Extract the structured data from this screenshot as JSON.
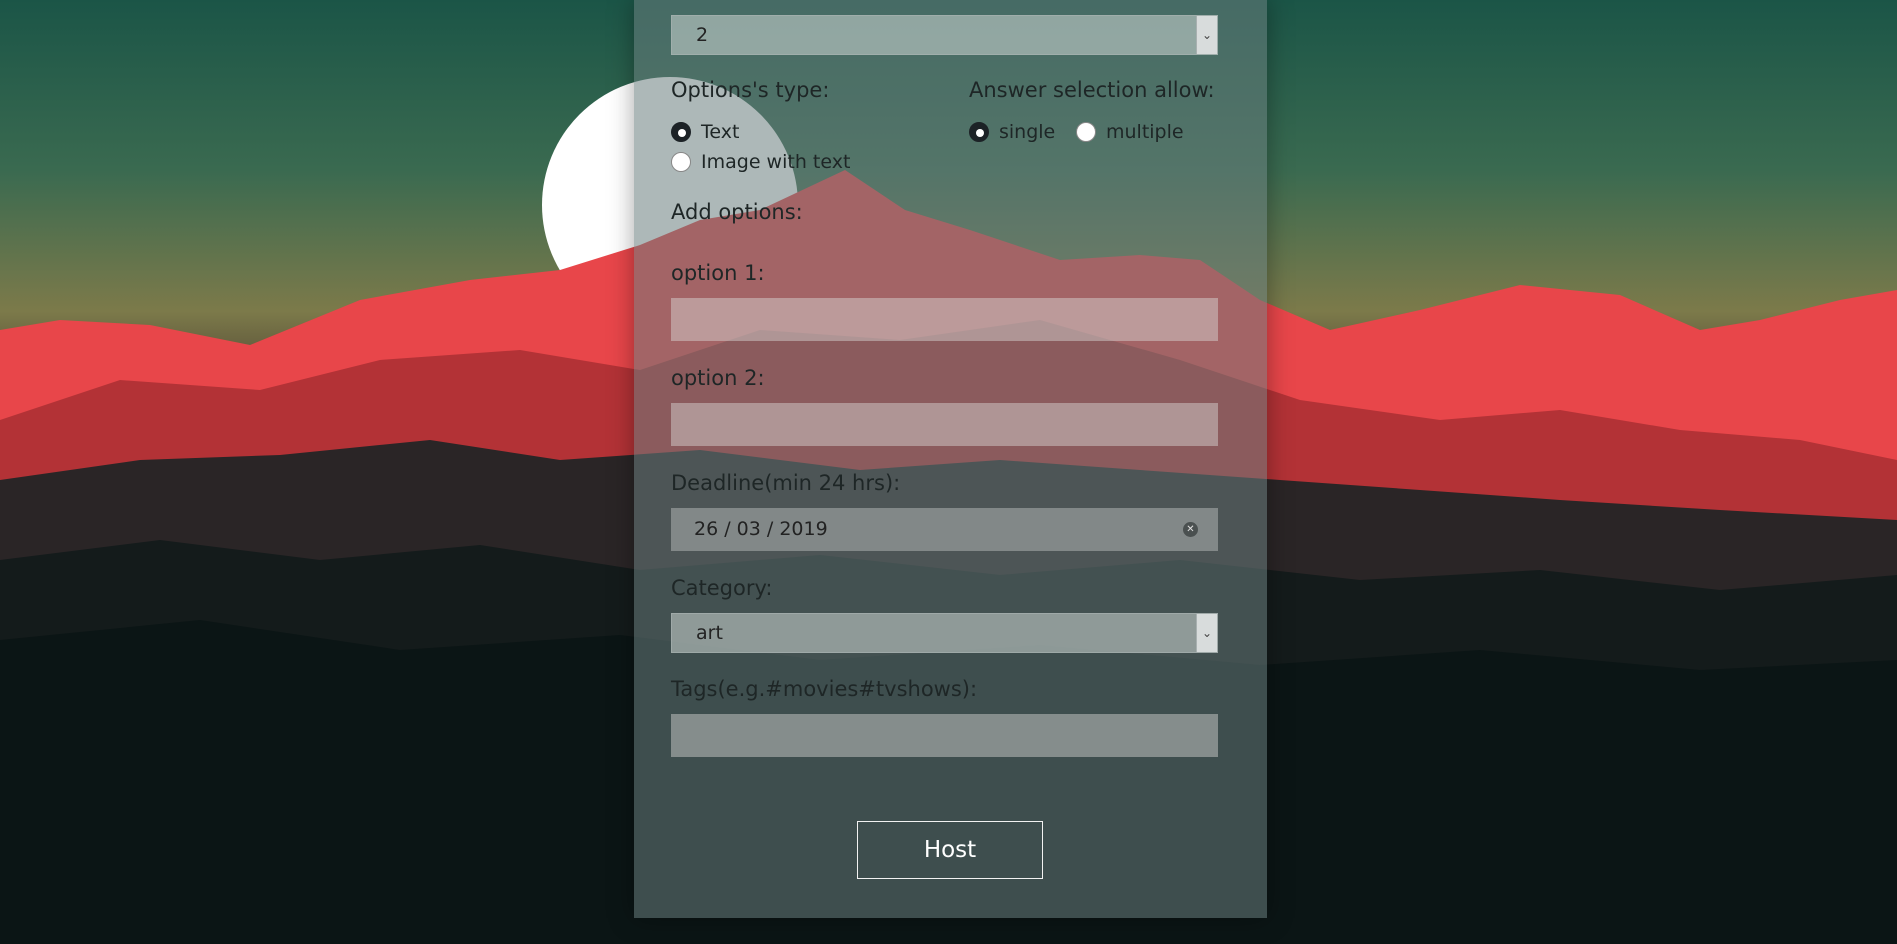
{
  "form": {
    "options_count": {
      "value": "2"
    },
    "options_type": {
      "label": "Options's type:",
      "choices": [
        {
          "label": "Text",
          "checked": true
        },
        {
          "label": "Image with text",
          "checked": false
        }
      ]
    },
    "answer_selection": {
      "label": "Answer selection allow:",
      "choices": [
        {
          "label": "single",
          "checked": true
        },
        {
          "label": "multiple",
          "checked": false
        }
      ]
    },
    "add_options_label": "Add options:",
    "options": [
      {
        "label": "option 1:",
        "value": ""
      },
      {
        "label": "option 2:",
        "value": ""
      }
    ],
    "deadline": {
      "label": "Deadline(min 24 hrs):",
      "value": "26 / 03 / 2019"
    },
    "category": {
      "label": "Category:",
      "value": "art"
    },
    "tags": {
      "label": "Tags(e.g.#movies#tvshows):",
      "value": ""
    },
    "submit_label": "Host"
  },
  "colors": {
    "sky_top": "#1f5a4a",
    "mountain_red": "#e8464a",
    "moon": "#ffffff",
    "panel": "#697d7d"
  }
}
